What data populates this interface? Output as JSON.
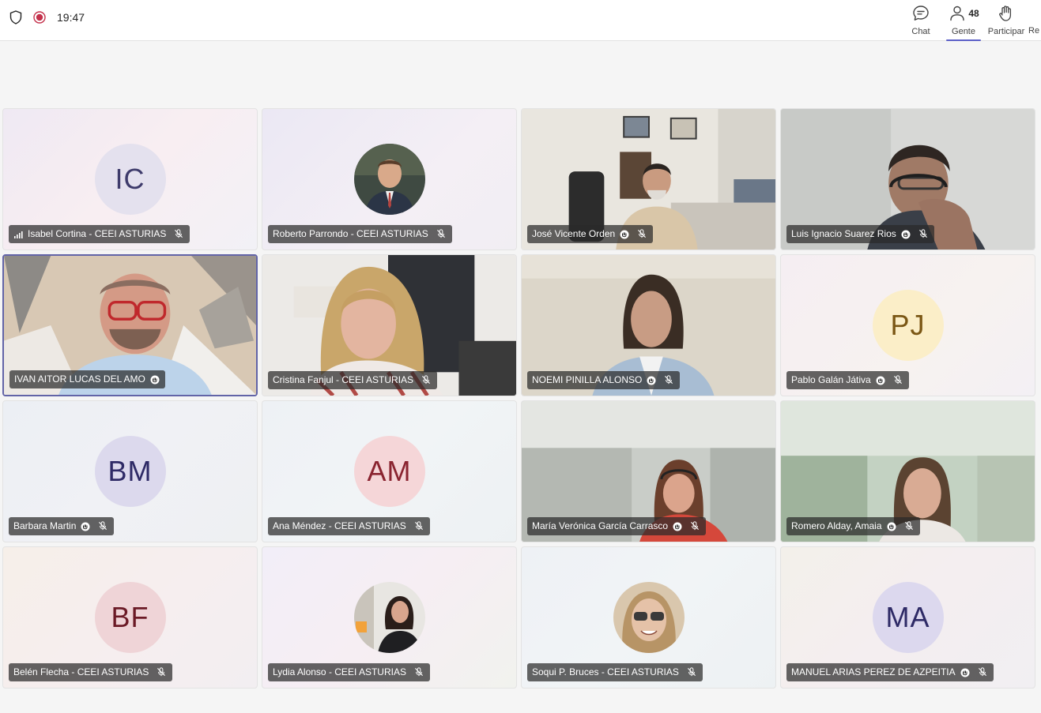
{
  "topbar": {
    "time": "19:47",
    "chat_label": "Chat",
    "people_label": "Gente",
    "people_count": "48",
    "raise_label": "Participar",
    "react_label": "Re"
  },
  "participants": [
    {
      "name": "Isabel Cortina - CEEI ASTURIAS",
      "initials": "IC",
      "muted": true,
      "signal": true
    },
    {
      "name": "Roberto Parrondo - CEEI ASTURIAS",
      "muted": true
    },
    {
      "name": "José Vicente Orden",
      "muted": true,
      "badge": "7"
    },
    {
      "name": "Luis Ignacio Suarez Rios",
      "muted": true
    },
    {
      "name": "IVAN AITOR LUCAS DEL AMO",
      "muted": false,
      "active_speaker": true
    },
    {
      "name": "Cristina Fanjul - CEEI ASTURIAS",
      "muted": true
    },
    {
      "name": "NOEMI PINILLA ALONSO",
      "muted": true
    },
    {
      "name": "Pablo Galán Játiva",
      "initials": "PJ",
      "muted": true
    },
    {
      "name": "Barbara Martin",
      "initials": "BM",
      "muted": true
    },
    {
      "name": "Ana Méndez - CEEI ASTURIAS",
      "initials": "AM",
      "muted": true
    },
    {
      "name": "María Verónica García Carrasco",
      "muted": true
    },
    {
      "name": "Romero Alday, Amaia",
      "muted": true
    },
    {
      "name": "Belén Flecha - CEEI ASTURIAS",
      "initials": "BF",
      "muted": true
    },
    {
      "name": "Lydia Alonso - CEEI ASTURIAS",
      "muted": true
    },
    {
      "name": "Soqui P. Bruces - CEEI ASTURIAS",
      "muted": true
    },
    {
      "name": "MANUEL ARIAS PEREZ DE AZPEITIA",
      "initials": "MA",
      "muted": true
    }
  ],
  "colors": {
    "accent": "#5b5fc7",
    "active_border": "#6264a7",
    "record": "#c4314b"
  }
}
